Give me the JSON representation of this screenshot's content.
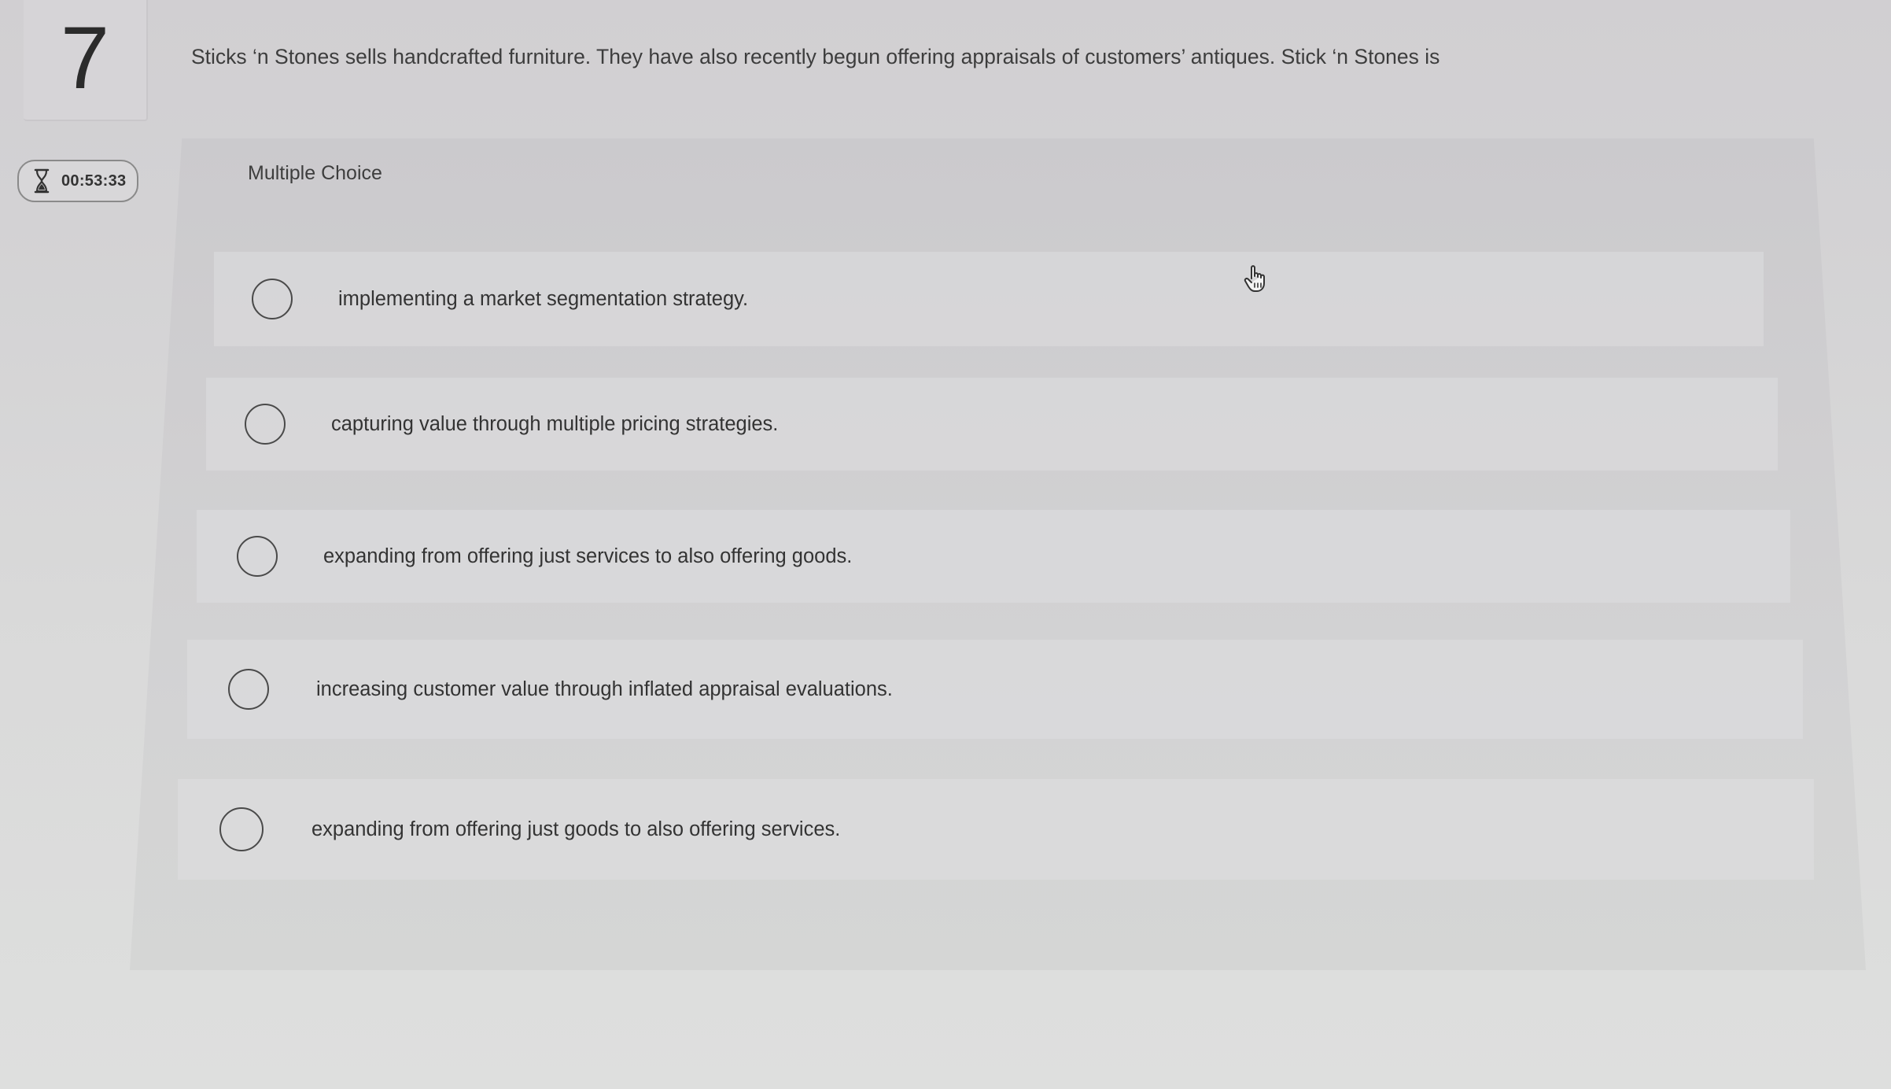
{
  "question": {
    "number": "7",
    "prompt": "Sticks ‘n Stones sells handcrafted furniture. They have also recently begun offering appraisals of customers’ antiques. Stick ‘n Stones is",
    "type_label": "Multiple Choice"
  },
  "timer": {
    "icon": "hourglass-icon",
    "value": "00:53:33"
  },
  "choices": [
    {
      "label": "implementing a market segmentation strategy."
    },
    {
      "label": "capturing value through multiple pricing strategies."
    },
    {
      "label": "expanding from offering just services to also offering goods."
    },
    {
      "label": "increasing customer value through inflated appraisal evaluations."
    },
    {
      "label": "expanding from offering just goods to also offering services."
    }
  ],
  "cursor": {
    "icon": "hand-pointer-icon"
  }
}
